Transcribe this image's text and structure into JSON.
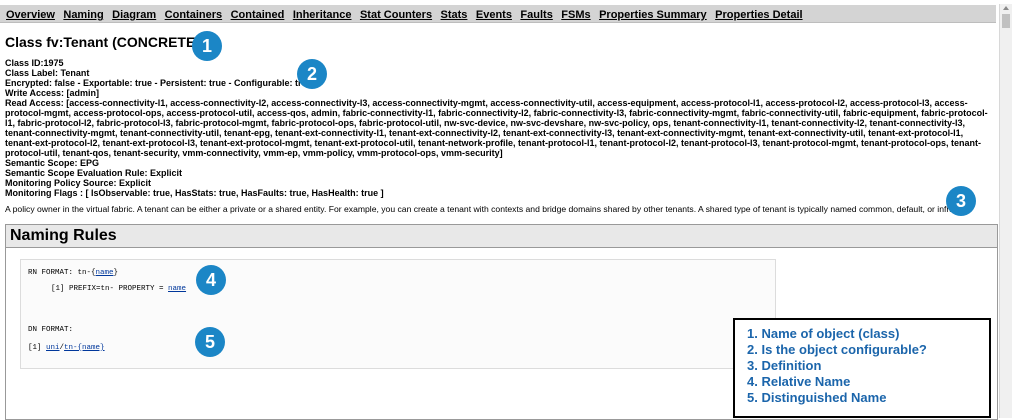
{
  "nav": {
    "items": [
      "Overview",
      "Naming",
      "Diagram",
      "Containers",
      "Contained",
      "Inheritance",
      "Stat Counters",
      "Stats",
      "Events",
      "Faults",
      "FSMs",
      "Properties Summary",
      "Properties Detail"
    ]
  },
  "page": {
    "title": "Class fv:Tenant (CONCRETE)",
    "class_id": "Class ID:1975",
    "class_label": "Class Label: Tenant",
    "encrypted": "Encrypted: false - Exportable: true - Persistent: true - Configurable: true",
    "write_access": "Write Access: [admin]",
    "read_access": "Read Access: [access-connectivity-l1, access-connectivity-l2, access-connectivity-l3, access-connectivity-mgmt, access-connectivity-util, access-equipment, access-protocol-l1, access-protocol-l2, access-protocol-l3, access-protocol-mgmt, access-protocol-ops, access-protocol-util, access-qos, admin, fabric-connectivity-l1, fabric-connectivity-l2, fabric-connectivity-l3, fabric-connectivity-mgmt, fabric-connectivity-util, fabric-equipment, fabric-protocol-l1, fabric-protocol-l2, fabric-protocol-l3, fabric-protocol-mgmt, fabric-protocol-ops, fabric-protocol-util, nw-svc-device, nw-svc-devshare, nw-svc-policy, ops, tenant-connectivity-l1, tenant-connectivity-l2, tenant-connectivity-l3, tenant-connectivity-mgmt, tenant-connectivity-util, tenant-epg, tenant-ext-connectivity-l1, tenant-ext-connectivity-l2, tenant-ext-connectivity-l3, tenant-ext-connectivity-mgmt, tenant-ext-connectivity-util, tenant-ext-protocol-l1, tenant-ext-protocol-l2, tenant-ext-protocol-l3, tenant-ext-protocol-mgmt, tenant-ext-protocol-util, tenant-network-profile, tenant-protocol-l1, tenant-protocol-l2, tenant-protocol-l3, tenant-protocol-mgmt, tenant-protocol-ops, tenant-protocol-util, tenant-qos, tenant-security, vmm-connectivity, vmm-ep, vmm-policy, vmm-protocol-ops, vmm-security]",
    "semantic_scope": "Semantic Scope: EPG",
    "semantic_scope_rule": "Semantic Scope Evaluation Rule: Explicit",
    "monitoring_policy": "Monitoring Policy Source: Explicit",
    "monitoring_flags": "Monitoring Flags : [ IsObservable: true, HasStats: true, HasFaults: true, HasHealth: true ]",
    "description": "A policy owner in the virtual fabric. A tenant can be either a private or a shared entity. For example, you can create a tenant with contexts and bridge domains shared by other tenants. A shared type of tenant is typically named common, default, or infra."
  },
  "naming": {
    "heading": "Naming Rules",
    "rn_format_label": "RN FORMAT: tn-{",
    "rn_format_link": "name",
    "rn_format_close": "}",
    "rn_prop_prefix": "[1] PREFIX=tn- PROPERTY = ",
    "rn_prop_link": "name",
    "dn_format_label": "DN FORMAT:",
    "dn_index": "[1] ",
    "dn_link1": "uni",
    "dn_sep": "/",
    "dn_link2": "tn-{name}"
  },
  "badges": [
    "1",
    "2",
    "3",
    "4",
    "5"
  ],
  "legend": [
    "1. Name of object (class)",
    "2.  Is the object configurable?",
    "3. Definition",
    "4. Relative Name",
    "5. Distinguished Name"
  ],
  "colors": {
    "badge": "#1b86c6",
    "legend_text": "#1b65ab",
    "nav_bg": "#d4d4d4"
  }
}
